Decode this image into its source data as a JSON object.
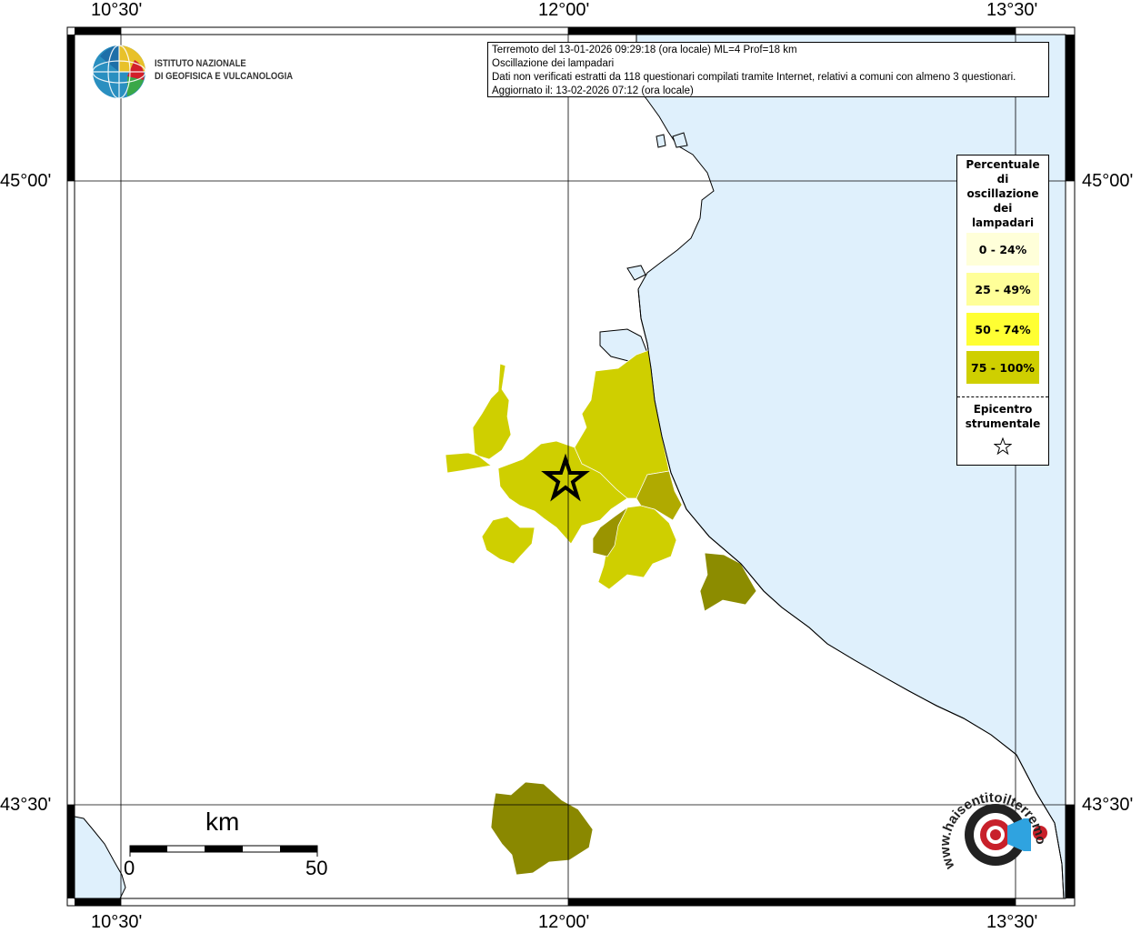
{
  "map": {
    "info_lines": [
      "Terremoto del 13-01-2026 09:29:18 (ora locale) ML=4 Prof=18 km",
      "Oscillazione dei lampadari",
      "Dati non verificati estratti da 118 questionari compilati tramite Internet, relativi a comuni con almeno 3 questionari.",
      "Aggiornato il: 13-02-2026 07:12 (ora locale)"
    ],
    "lon_labels": [
      "10°30'",
      "12°00'",
      "13°30'"
    ],
    "lat_labels": [
      "45°00'",
      "43°30'"
    ],
    "colors": {
      "sea": "#dff0fc",
      "land": "#ffffff"
    }
  },
  "logos": {
    "ingv_line1": "ISTITUTO NAZIONALE",
    "ingv_line2": "DI GEOFISICA E VULCANOLOGIA",
    "hsit_text": "www.haisentitoilterremoto.it"
  },
  "legend": {
    "title_lines": [
      "Percentuale",
      "di",
      "oscillazione",
      "dei",
      "lampadari"
    ],
    "classes": [
      {
        "label": "0 - 24%",
        "color": "#ffffd9"
      },
      {
        "label": "25 - 49%",
        "color": "#ffff99"
      },
      {
        "label": "50 - 74%",
        "color": "#ffff33"
      },
      {
        "label": "75 - 100%",
        "color": "#cfcf00"
      }
    ],
    "epicenter_lines": [
      "Epicentro",
      "strumentale"
    ],
    "epicenter_icon": "star-outline-icon"
  },
  "municipalities": [
    {
      "name": "north-west-strip",
      "class": "75 - 100%"
    },
    {
      "name": "west-block",
      "class": "75 - 100%"
    },
    {
      "name": "central-epicenter",
      "class": "75 - 100%"
    },
    {
      "name": "south-west-block",
      "class": "75 - 100%"
    },
    {
      "name": "north-east-coastal",
      "class": "75 - 100%"
    },
    {
      "name": "south-central",
      "class": "75 - 100%"
    },
    {
      "name": "east-coastal-dark",
      "value_color": "#b0aa00"
    },
    {
      "name": "inner-dark",
      "value_color": "#9a9400"
    },
    {
      "name": "south-east-dark",
      "value_color": "#8c8c00"
    },
    {
      "name": "far-south-dark",
      "value_color": "#8a8800"
    }
  ],
  "scale": {
    "unit": "km",
    "min_label": "0",
    "max_label": "50"
  }
}
